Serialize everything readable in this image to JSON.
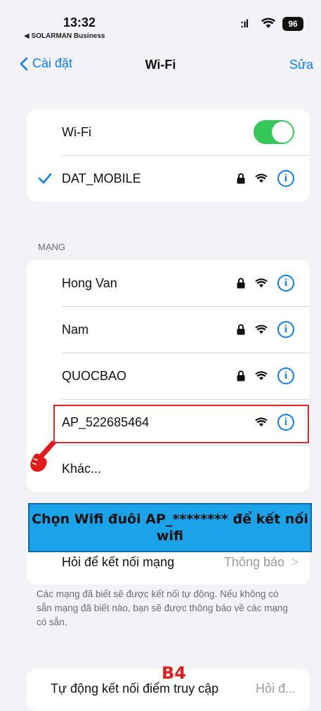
{
  "status_bar": {
    "time": "13:32",
    "back_app": "◀ SOLARMAN Business",
    "signal": ":ıl",
    "battery": "96"
  },
  "nav": {
    "back_label": "Cài đặt",
    "title": "Wi-Fi",
    "edit_label": "Sửa"
  },
  "wifi_card": {
    "toggle_label": "Wi-Fi",
    "toggle_on": true,
    "connected_network": "DAT_MOBILE"
  },
  "networks_section": {
    "label": "MẠNG",
    "items": [
      {
        "name": "Hong Van",
        "locked": true
      },
      {
        "name": "Nam",
        "locked": true
      },
      {
        "name": "QUOCBAO",
        "locked": true
      },
      {
        "name": "AP_522685464",
        "locked": false
      }
    ],
    "other_label": "Khác..."
  },
  "callout": {
    "text": "Chọn Wifi đuôi AP_******** để kết nối wifi",
    "color": "#1aa3e8"
  },
  "ask_join": {
    "label": "Hỏi để kết nối mạng",
    "value": "Thông báo"
  },
  "footnote": "Các mạng đã biết sẽ được kết nối tự động. Nếu không có sẵn mạng đã biết nào, bạn sẽ được thông báo về các mạng có sẵn.",
  "auto_join": {
    "label": "Tự động kết nối điểm truy cập",
    "value": "Hỏi đ..."
  },
  "step_label": "B4",
  "colors": {
    "accent": "#0a7cff",
    "toggle_on": "#34c759",
    "highlight": "#e5252a"
  }
}
